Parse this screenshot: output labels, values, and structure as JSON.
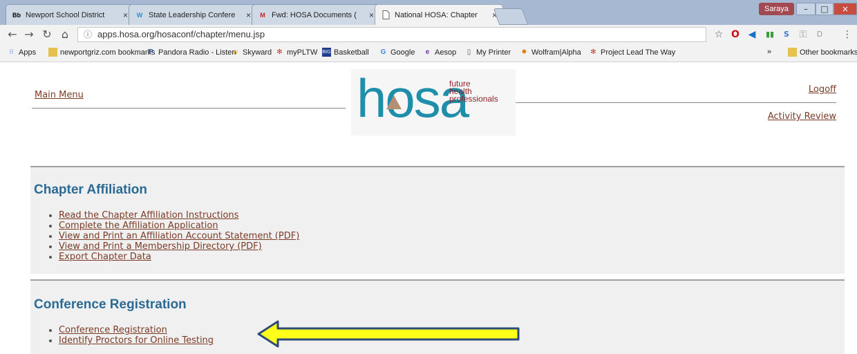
{
  "browser": {
    "tabs": [
      {
        "label": "Newport School District",
        "favicon": "Bb"
      },
      {
        "label": "State Leadership Confere",
        "favicon": "W"
      },
      {
        "label": "Fwd: HOSA Documents (",
        "favicon": "M"
      },
      {
        "label": "National HOSA: Chapter",
        "favicon": "page"
      }
    ],
    "user": "Saraya",
    "url": "apps.hosa.org/hosaconf/chapter/menu.jsp",
    "bookmarks": [
      "Apps",
      "newportgriz.com bookmarks",
      "Pandora Radio - Listen",
      "Skyward",
      "myPLTW",
      "Basketball",
      "Google",
      "Aesop",
      "My Printer",
      "Wolfram|Alpha",
      "Project Lead The Way"
    ],
    "overflow": "»",
    "other_bookmarks": "Other bookmarks"
  },
  "header": {
    "main_menu": "Main Menu",
    "logoff": "Logoff",
    "activity_review": "Activity Review",
    "logo": {
      "word": "hosa",
      "tag1": "future",
      "tag2": "health",
      "tag3": "professionals"
    }
  },
  "sections": [
    {
      "title": "Chapter Affiliation",
      "links": [
        "Read the Chapter Affiliation Instructions",
        "Complete the Affiliation Application",
        "View and Print an Affiliation Account Statement (PDF)",
        "View and Print a Membership Directory (PDF)",
        "Export Chapter Data"
      ]
    },
    {
      "title": "Conference Registration",
      "links": [
        "Conference Registration",
        "Identify Proctors for Online Testing"
      ]
    }
  ],
  "colors": {
    "link": "#7a3b26",
    "heading": "#2a6a93",
    "logo_blue": "#1e8eaa",
    "logo_red": "#8c2327",
    "arrow_fill": "#ffff1a",
    "arrow_stroke": "#2e4a78"
  }
}
